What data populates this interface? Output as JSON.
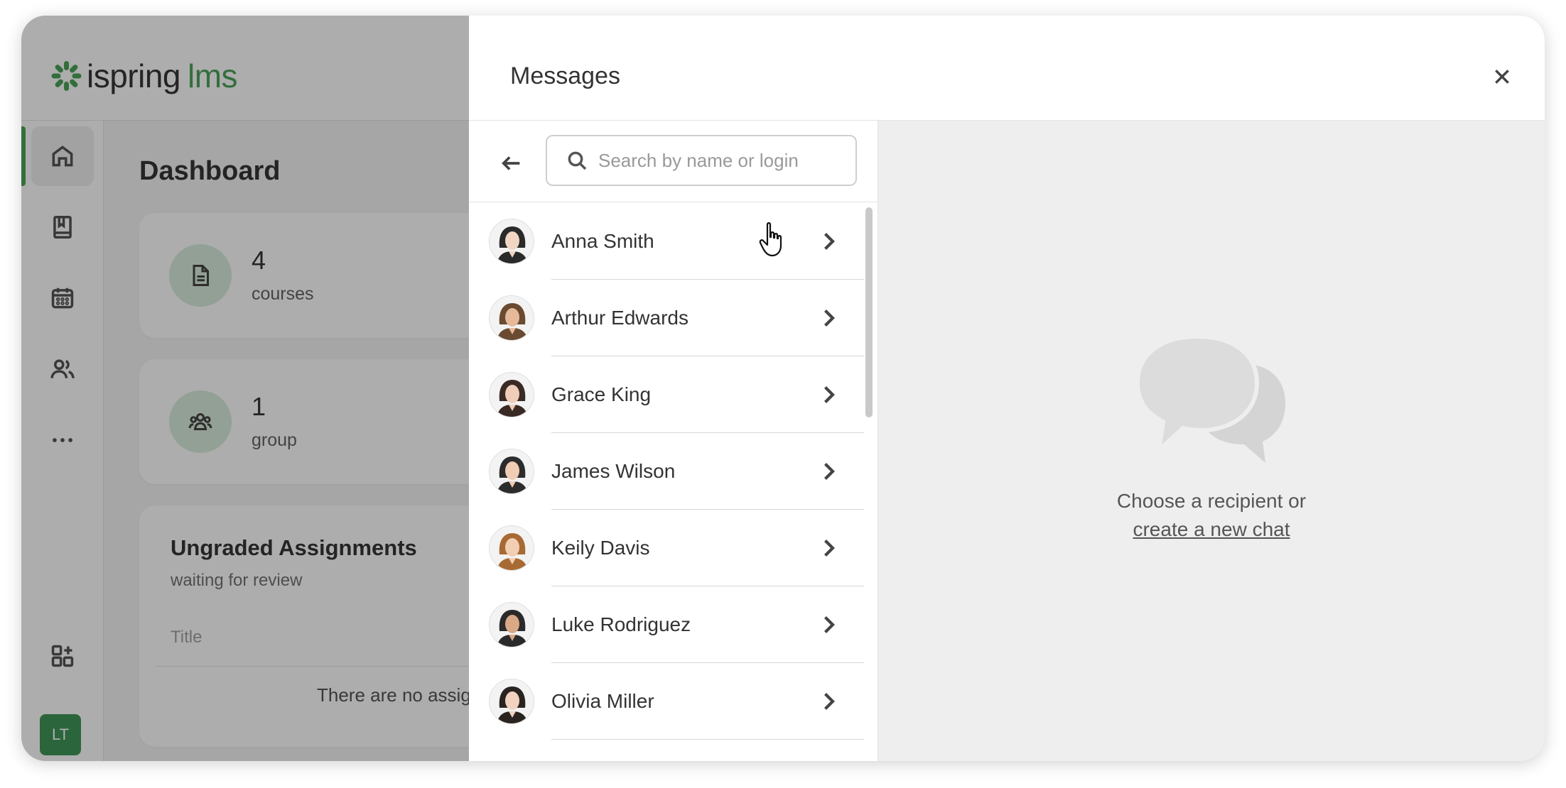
{
  "app": {
    "logo_text": "ispring",
    "logo_suffix": "lms",
    "brand_color": "#3a9a4a"
  },
  "sidebar": {
    "items": [
      {
        "icon": "home-icon",
        "active": true
      },
      {
        "icon": "book-icon",
        "active": false
      },
      {
        "icon": "calendar-icon",
        "active": false
      },
      {
        "icon": "users-icon",
        "active": false
      },
      {
        "icon": "more-icon",
        "active": false
      },
      {
        "icon": "add-widget-icon",
        "active": false
      }
    ],
    "user_initials": "LT"
  },
  "dashboard": {
    "title": "Dashboard",
    "stats": [
      {
        "value": "4",
        "label": "courses",
        "icon": "document-icon"
      },
      {
        "value": "1",
        "label": "group",
        "icon": "group-icon"
      }
    ],
    "ungraded": {
      "title": "Ungraded Assignments",
      "subtitle": "waiting for review",
      "column_title": "Title",
      "empty_text": "There are no assig"
    }
  },
  "messages": {
    "title": "Messages",
    "search_placeholder": "Search by name or login",
    "contacts": [
      {
        "name": "Anna Smith",
        "avatar_color": "#2a2a2a",
        "skin": "#f2d6c4"
      },
      {
        "name": "Arthur Edwards",
        "avatar_color": "#6a4a30",
        "skin": "#e6b99a"
      },
      {
        "name": "Grace King",
        "avatar_color": "#3a2a25",
        "skin": "#efcdb8"
      },
      {
        "name": "James Wilson",
        "avatar_color": "#2c2c2c",
        "skin": "#f0cdb4"
      },
      {
        "name": "Keily Davis",
        "avatar_color": "#a86a35",
        "skin": "#f2cfb2"
      },
      {
        "name": "Luke Rodriguez",
        "avatar_color": "#2a2a2a",
        "skin": "#d9a884"
      },
      {
        "name": "Olivia Miller",
        "avatar_color": "#2a2420",
        "skin": "#f1d3c0"
      }
    ],
    "empty_state": {
      "line1": "Choose a recipient or",
      "link": "create a new chat"
    }
  }
}
